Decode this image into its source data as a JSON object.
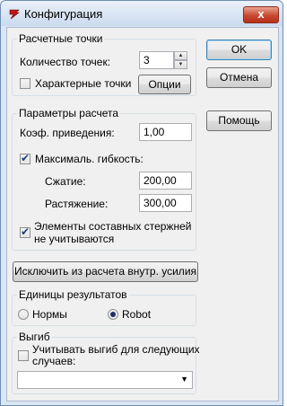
{
  "window": {
    "title": "Конфигурация",
    "close_label": "x"
  },
  "buttons": {
    "ok": "OK",
    "cancel": "Отмена",
    "help": "Помощь"
  },
  "calc_points": {
    "title": "Расчетные точки",
    "count_label": "Количество точек:",
    "count_value": "3",
    "characteristic_label": "Характерные точки",
    "characteristic_checked": false,
    "options_button": "Опции"
  },
  "calc_params": {
    "title": "Параметры расчета",
    "reduction_label": "Коэф. приведения:",
    "reduction_value": "1,00",
    "max_flex_label": "Максималь. гибкость:",
    "max_flex_checked": true,
    "compression_label": "Сжатие:",
    "compression_value": "200,00",
    "tension_label": "Растяжение:",
    "tension_value": "300,00",
    "composite_line1": "Элементы составных стержней",
    "composite_line2": "не учитываются",
    "composite_checked": true
  },
  "exclude_button": "Исключить из расчета внутр. усилия",
  "units": {
    "title": "Единицы результатов",
    "norms_label": "Нормы",
    "robot_label": "Robot",
    "selected": "Robot"
  },
  "bending": {
    "title": "Выгиб",
    "consider_line1": "Учитывать выгиб для следующих",
    "consider_line2": "случаев:",
    "consider_checked": false,
    "cases_value": ""
  }
}
